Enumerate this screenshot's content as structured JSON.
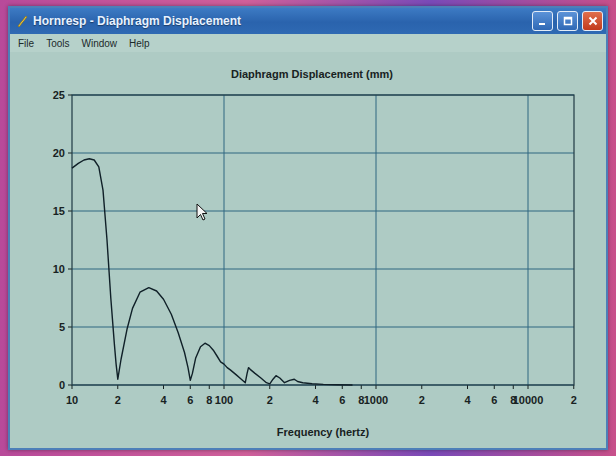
{
  "window": {
    "title": "Hornresp - Diaphragm Displacement"
  },
  "menu": [
    "File",
    "Tools",
    "Window",
    "Help"
  ],
  "chart": {
    "title": "Diaphragm Displacement (mm)",
    "y_ticks": [
      "0",
      "5",
      "10",
      "15",
      "20",
      "25"
    ],
    "x_ticks": [
      "10",
      "2",
      "4",
      "6",
      "8",
      "100",
      "2",
      "4",
      "6",
      "8",
      "1000",
      "2",
      "4",
      "6",
      "8",
      "10000",
      "2"
    ],
    "x_axis_title": "Frequency (hertz)",
    "series": [
      {
        "frequencies": [
          10,
          11,
          12,
          13,
          14,
          15,
          16,
          17,
          18,
          19,
          19.5,
          20,
          21,
          23,
          25,
          28,
          32,
          36,
          40,
          45,
          50,
          55,
          58,
          60,
          62,
          65,
          70,
          75,
          80,
          85,
          90,
          95,
          100,
          105,
          110,
          120,
          130,
          138,
          142,
          145,
          150,
          160,
          175,
          190,
          200,
          210,
          220,
          233,
          250,
          270,
          290,
          305,
          330,
          380,
          450,
          550,
          700
        ],
        "values": [
          18.7,
          19.1,
          19.4,
          19.5,
          19.4,
          18.8,
          16.8,
          12.5,
          7.5,
          3.5,
          1.8,
          0.5,
          2.2,
          4.8,
          6.6,
          8.0,
          8.4,
          8.1,
          7.4,
          6.1,
          4.5,
          2.8,
          1.5,
          0.4,
          1.0,
          2.3,
          3.3,
          3.6,
          3.4,
          3.0,
          2.5,
          2.0,
          1.8,
          1.5,
          1.3,
          0.9,
          0.5,
          0.2,
          1.0,
          1.5,
          1.3,
          1.0,
          0.6,
          0.2,
          0.1,
          0.5,
          0.8,
          0.6,
          0.2,
          0.4,
          0.5,
          0.3,
          0.2,
          0.1,
          0.05,
          0.02,
          0
        ]
      }
    ]
  }
}
